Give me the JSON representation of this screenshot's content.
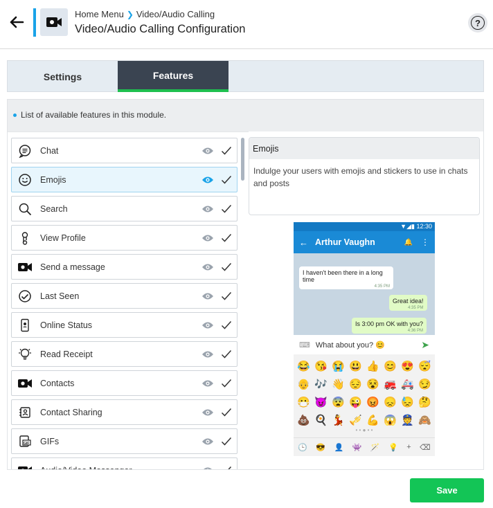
{
  "header": {
    "breadcrumb_root": "Home Menu",
    "breadcrumb_current": "Video/Audio Calling",
    "title": "Video/Audio Calling Configuration"
  },
  "tabs": [
    {
      "label": "Settings",
      "active": false
    },
    {
      "label": "Features",
      "active": true
    }
  ],
  "info_text": "List of available features in this module.",
  "features": [
    {
      "label": "Chat",
      "icon": "chat-bubble-icon",
      "selected": false
    },
    {
      "label": "Emojis",
      "icon": "smiley-icon",
      "selected": true
    },
    {
      "label": "Search",
      "icon": "search-icon",
      "selected": false
    },
    {
      "label": "View Profile",
      "icon": "profile-icon",
      "selected": false
    },
    {
      "label": "Send a message",
      "icon": "video-call-icon",
      "selected": false
    },
    {
      "label": "Last Seen",
      "icon": "check-circle-icon",
      "selected": false
    },
    {
      "label": "Online Status",
      "icon": "mobile-user-icon",
      "selected": false
    },
    {
      "label": "Read Receipt",
      "icon": "lightbulb-icon",
      "selected": false
    },
    {
      "label": "Contacts",
      "icon": "video-call-icon",
      "selected": false
    },
    {
      "label": "Contact Sharing",
      "icon": "contact-card-icon",
      "selected": false
    },
    {
      "label": "GIFs",
      "icon": "gif-icon",
      "selected": false
    },
    {
      "label": "Audio/Video Messenger",
      "icon": "video-call-icon",
      "selected": false
    }
  ],
  "detail": {
    "title": "Emojis",
    "description": "Indulge your users with emojis and stickers to use in chats and posts"
  },
  "preview": {
    "status_time": "12:30",
    "contact_name": "Arthur Vaughn",
    "messages": [
      {
        "text": "I haven't been there in a long time",
        "time": "4:35 PM",
        "direction": "in"
      },
      {
        "text": "Great idea!",
        "time": "4:35 PM",
        "direction": "out"
      },
      {
        "text": "Is 3:00 pm OK with you?",
        "time": "4:36 PM",
        "direction": "out"
      }
    ],
    "input_text": "What about you? 😊",
    "emojis": [
      "😂",
      "😘",
      "😭",
      "😃",
      "👍",
      "😊",
      "😍",
      "😴",
      "👴",
      "🎶",
      "👋",
      "😔",
      "😵",
      "🚒",
      "🚑",
      "😏",
      "😷",
      "😈",
      "😨",
      "😜",
      "😡",
      "😞",
      "😓",
      "🤔",
      "💩",
      "🍳",
      "💃",
      "🎺",
      "💪",
      "😱",
      "👮",
      "🙈"
    ],
    "emoji_tabs": [
      "🕒",
      "😎",
      "👤",
      "👾",
      "🪄",
      "💡",
      "+",
      "⌫"
    ]
  },
  "colors": {
    "accent": "#1aa3e8",
    "tab_active_bg": "#3a4451",
    "tab_active_underline": "#1fbf4f",
    "save_button": "#13c556"
  },
  "save_label": "Save"
}
